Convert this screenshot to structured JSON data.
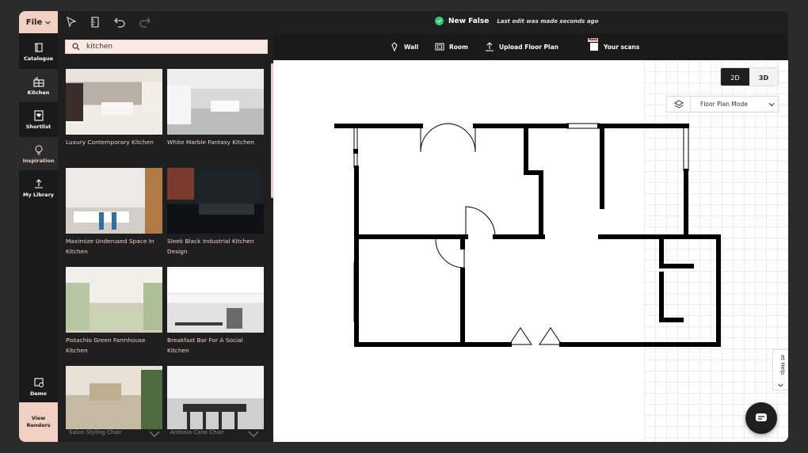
{
  "topbar": {
    "file_label": "File",
    "project_name": "New False",
    "last_edit": "Last edit was made seconds ago",
    "icons": [
      "select-cursor-icon",
      "measure-icon",
      "undo-icon",
      "redo-icon"
    ]
  },
  "rail": {
    "items": [
      {
        "label": "Catalogue",
        "icon": "catalogue-icon"
      },
      {
        "label": "Kitchen",
        "icon": "kitchen-icon"
      },
      {
        "label": "Shortlist",
        "icon": "shortlist-icon"
      },
      {
        "label": "Inspiration",
        "icon": "lightbulb-icon"
      },
      {
        "label": "My Library",
        "icon": "upload-icon"
      },
      {
        "label": "Demo",
        "icon": "demo-icon"
      }
    ],
    "view_renders": "View Renders"
  },
  "search": {
    "value": "kitchen",
    "placeholder": ""
  },
  "cards": [
    {
      "label": "Luxury Contemporary Kitchen"
    },
    {
      "label": "White Marble Fantasy Kitchen"
    },
    {
      "label": "Maximize Underused Space In Kitchen"
    },
    {
      "label": "Sleek Black Industrial Kitchen Design"
    },
    {
      "label": "Pistachio Green Farmhouse Kitchen"
    },
    {
      "label": "Breakfast Bar For A Social Kitchen"
    },
    {
      "label": "Salon Styling Chair"
    },
    {
      "label": "Antonia Cane Chair"
    }
  ],
  "toolbar": {
    "wall": "Wall",
    "room": "Room",
    "upload": "Upload Floor Plan",
    "scans": "Your scans",
    "new_badge": "New"
  },
  "canvas": {
    "mode_2d": "2D",
    "mode_3d": "3D",
    "floor_plan_mode": "Floor Plan Mode",
    "help": "et Help"
  },
  "colors": {
    "accent": "#f2cfc3",
    "dark": "#1f1f1f",
    "success": "#2ecc71"
  }
}
